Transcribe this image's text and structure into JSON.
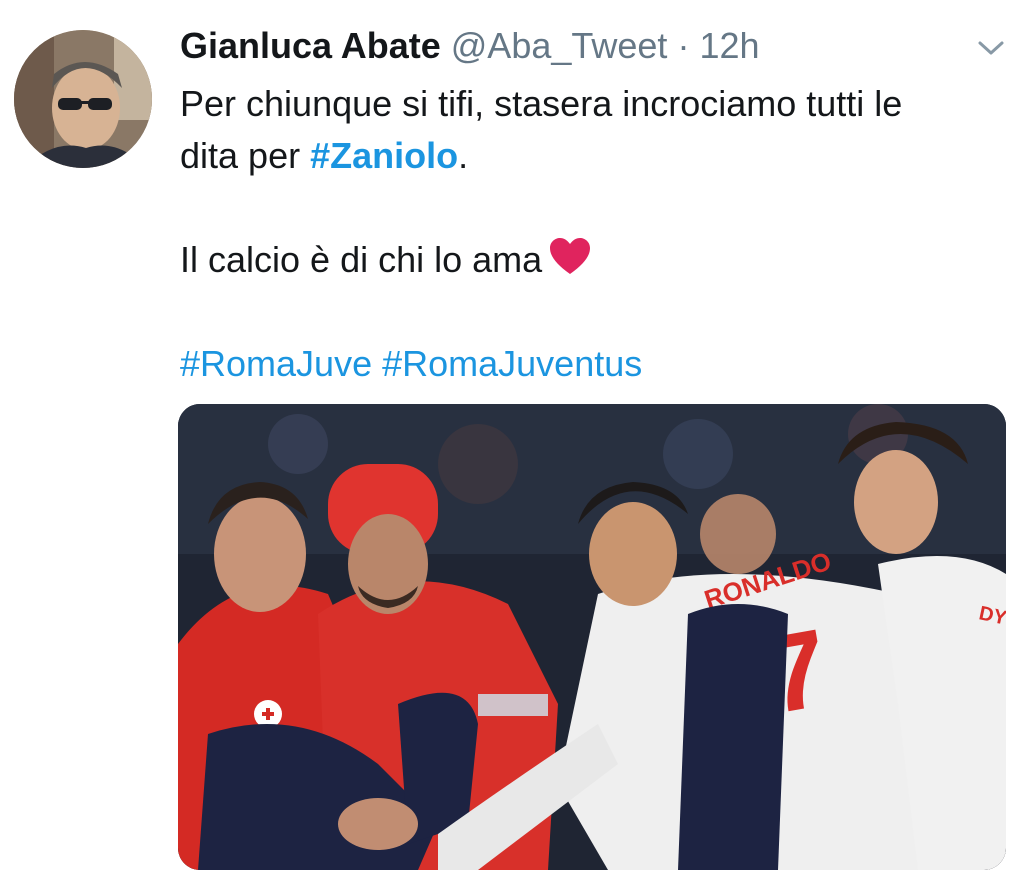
{
  "tweet": {
    "author_name": "Gianluca Abate",
    "handle": "@Aba_Tweet",
    "separator": "·",
    "timestamp": "12h",
    "lines": [
      "Per chiunque si tifi, stasera incrociamo tutti le",
      "dita per "
    ],
    "mention_tag": "#Zaniolo",
    "mention_suffix": ".",
    "line_love": "Il calcio è di chi lo ama",
    "hashtag_1": "#RomaJuve",
    "hashtag_2": "#RomaJuventus"
  },
  "media": {
    "shirt_name": "RONALDO",
    "shirt_number": "7",
    "partial_shirt_name": "DYBALA"
  },
  "colors": {
    "link": "#1b95e0",
    "heart": "#e0245e",
    "secondary_text": "#657786"
  },
  "icons": {
    "menu": "chevron-down-icon",
    "emoji": "red-heart-icon"
  }
}
